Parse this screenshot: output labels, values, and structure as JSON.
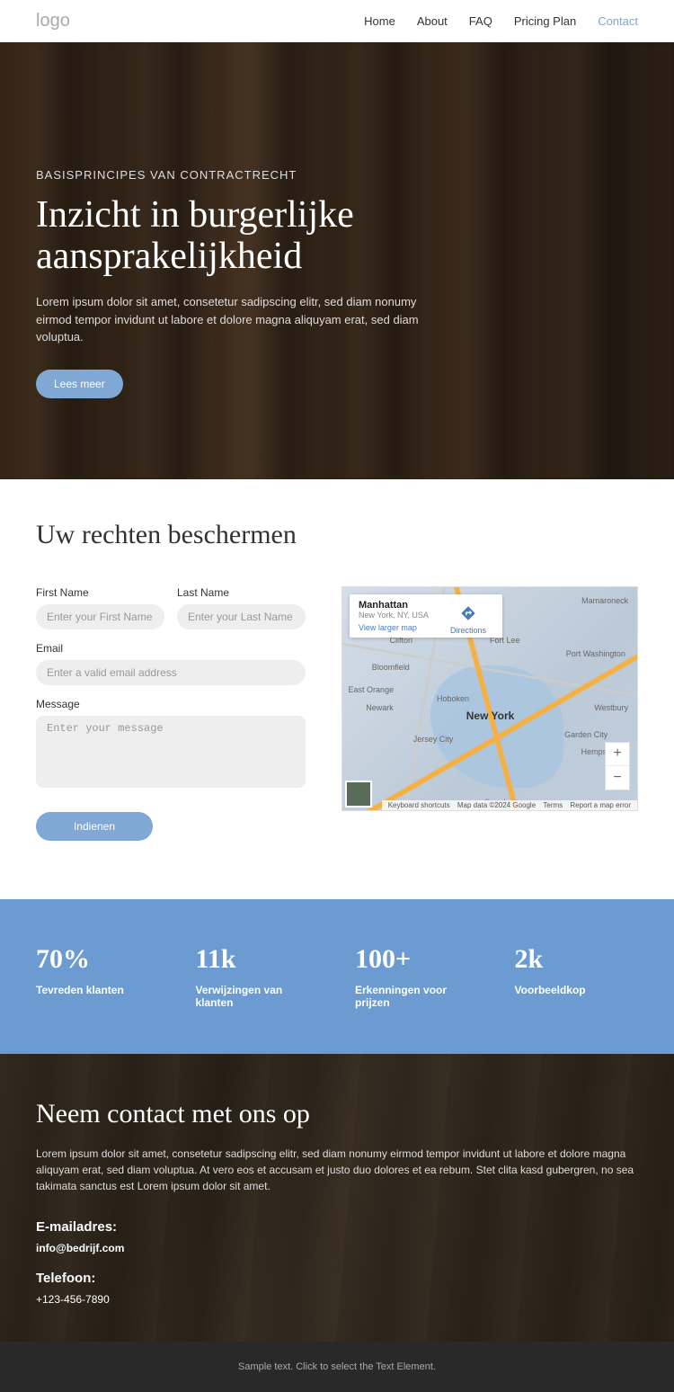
{
  "header": {
    "logo": "logo",
    "nav": {
      "home": "Home",
      "about": "About",
      "faq": "FAQ",
      "pricing": "Pricing Plan",
      "contact": "Contact"
    }
  },
  "hero": {
    "eyebrow": "BASISPRINCIPES VAN CONTRACTRECHT",
    "title": "Inzicht in burgerlijke aansprakelijkheid",
    "text": "Lorem ipsum dolor sit amet, consetetur sadipscing elitr, sed diam nonumy eirmod tempor invidunt ut labore et dolore magna aliquyam erat, sed diam voluptua.",
    "button": "Lees meer"
  },
  "form": {
    "title": "Uw rechten beschermen",
    "first_name_label": "First Name",
    "first_name_placeholder": "Enter your First Name",
    "last_name_label": "Last Name",
    "last_name_placeholder": "Enter your Last Name",
    "email_label": "Email",
    "email_placeholder": "Enter a valid email address",
    "message_label": "Message",
    "message_placeholder": "Enter your message",
    "submit": "Indienen"
  },
  "map": {
    "info_title": "Manhattan",
    "info_sub": "New York, NY, USA",
    "view_larger": "View larger map",
    "directions": "Directions",
    "city": "New York",
    "labels": {
      "clifton": "Clifton",
      "fortlee": "Fort Lee",
      "bloomfield": "Bloomfield",
      "newark": "Newark",
      "hoboken": "Hoboken",
      "jerseycity": "Jersey City",
      "eastorange": "East Orange",
      "mamaroneck": "Mamaroneck",
      "portwash": "Port Washington",
      "westbury": "Westbury",
      "hempstead": "Hempstead",
      "gardencity": "Garden City"
    },
    "zoom_in": "+",
    "zoom_out": "−",
    "google": "Google",
    "footer": {
      "shortcuts": "Keyboard shortcuts",
      "mapdata": "Map data ©2024 Google",
      "terms": "Terms",
      "report": "Report a map error"
    }
  },
  "stats": [
    {
      "value": "70%",
      "label": "Tevreden klanten"
    },
    {
      "value": "11k",
      "label": "Verwijzingen van klanten"
    },
    {
      "value": "100+",
      "label": "Erkenningen voor prijzen"
    },
    {
      "value": "2k",
      "label": "Voorbeeldkop"
    }
  ],
  "contact": {
    "title": "Neem contact met ons op",
    "text": "Lorem ipsum dolor sit amet, consetetur sadipscing elitr, sed diam nonumy eirmod tempor invidunt ut labore et dolore magna aliquyam erat, sed diam voluptua. At vero eos et accusam et justo duo dolores et ea rebum. Stet clita kasd gubergren, no sea takimata sanctus est Lorem ipsum dolor sit amet.",
    "email_label": "E-mailadres:",
    "email_value": "info@bedrijf.com",
    "phone_label": "Telefoon:",
    "phone_value": "+123-456-7890"
  },
  "footer": {
    "text": "Sample text. Click to select the Text Element."
  }
}
